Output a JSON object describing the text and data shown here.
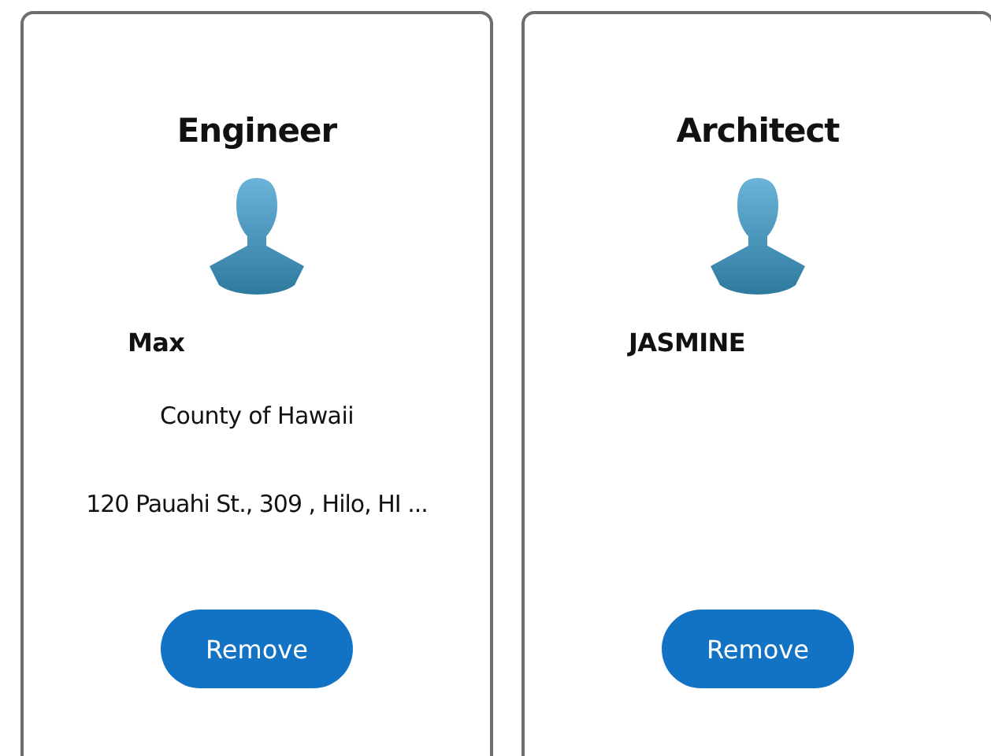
{
  "cards": [
    {
      "title": "Engineer",
      "name": "Max",
      "organization": "County of Hawaii",
      "address": "120 Pauahi St., 309 , Hilo, HI ...",
      "button": "Remove"
    },
    {
      "title": "Architect",
      "name": "JASMINE",
      "button": "Remove"
    }
  ]
}
